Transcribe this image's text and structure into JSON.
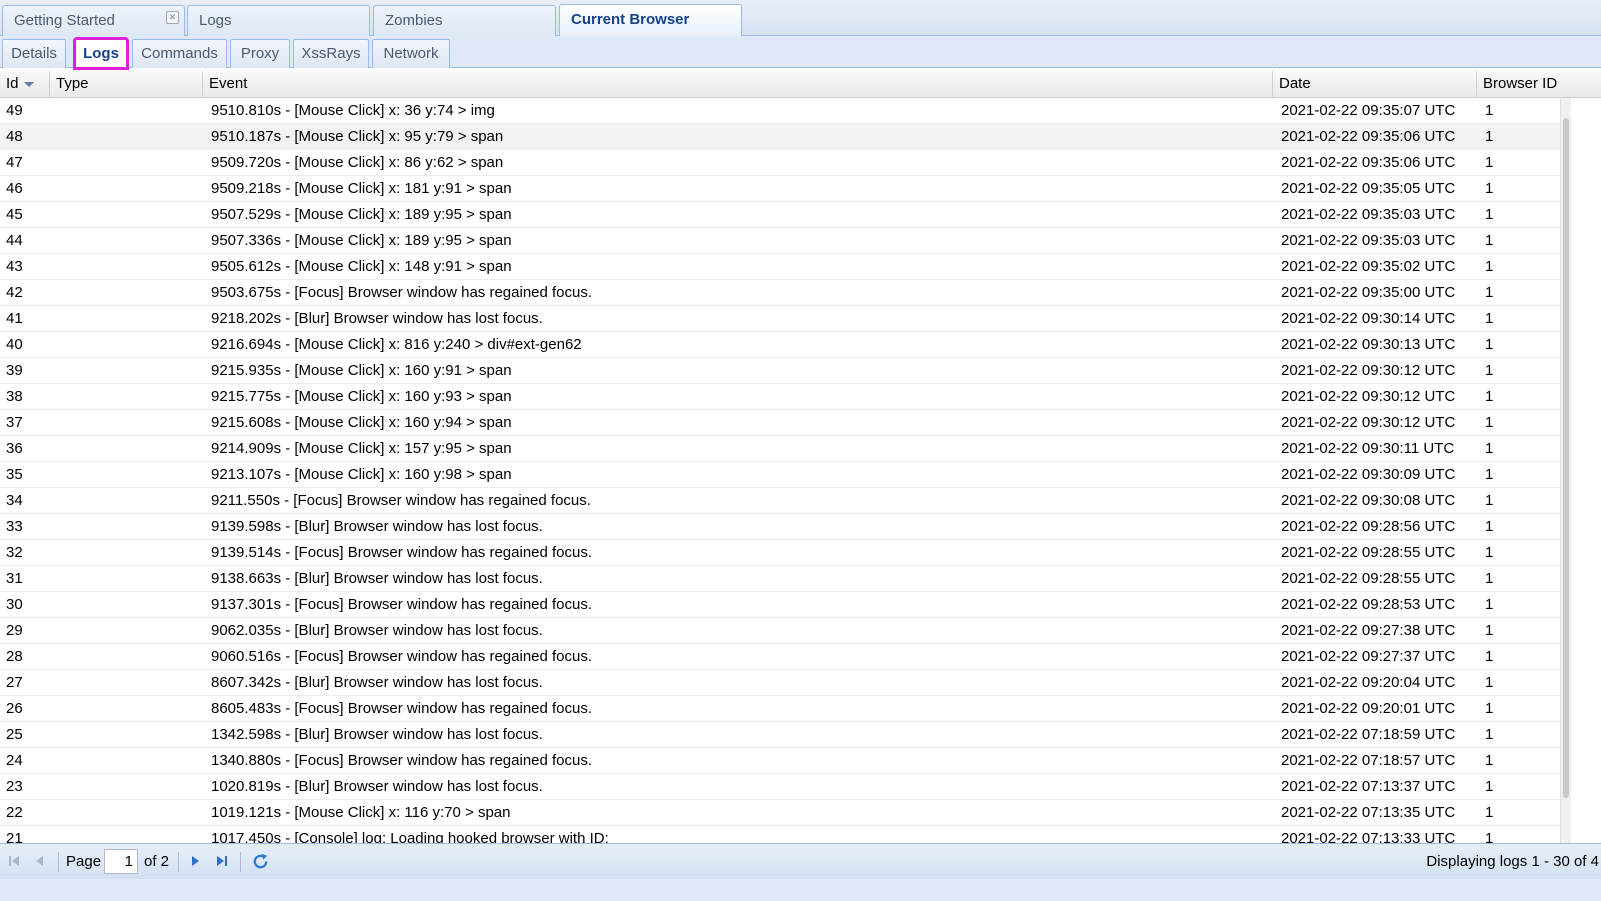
{
  "top_tabs": [
    {
      "label": "Getting Started",
      "closable": true
    },
    {
      "label": "Logs"
    },
    {
      "label": "Zombies"
    },
    {
      "label": "Current Browser",
      "active": true
    }
  ],
  "sub_tabs": [
    {
      "label": "Details"
    },
    {
      "label": "Logs",
      "active": true
    },
    {
      "label": "Commands"
    },
    {
      "label": "Proxy"
    },
    {
      "label": "XssRays"
    },
    {
      "label": "Network"
    }
  ],
  "grid": {
    "columns": {
      "id": "Id",
      "type": "Type",
      "event": "Event",
      "date": "Date",
      "browser_id": "Browser ID"
    },
    "rows": [
      {
        "id": "49",
        "type": "",
        "event": "9510.810s - [Mouse Click] x: 36 y:74 > img",
        "date": "2021-02-22 09:35:07 UTC",
        "browser_id": "1"
      },
      {
        "id": "48",
        "type": "",
        "event": "9510.187s - [Mouse Click] x: 95 y:79 > span",
        "date": "2021-02-22 09:35:06 UTC",
        "browser_id": "1"
      },
      {
        "id": "47",
        "type": "",
        "event": "9509.720s - [Mouse Click] x: 86 y:62 > span",
        "date": "2021-02-22 09:35:06 UTC",
        "browser_id": "1"
      },
      {
        "id": "46",
        "type": "",
        "event": "9509.218s - [Mouse Click] x: 181 y:91 > span",
        "date": "2021-02-22 09:35:05 UTC",
        "browser_id": "1"
      },
      {
        "id": "45",
        "type": "",
        "event": "9507.529s - [Mouse Click] x: 189 y:95 > span",
        "date": "2021-02-22 09:35:03 UTC",
        "browser_id": "1"
      },
      {
        "id": "44",
        "type": "",
        "event": "9507.336s - [Mouse Click] x: 189 y:95 > span",
        "date": "2021-02-22 09:35:03 UTC",
        "browser_id": "1"
      },
      {
        "id": "43",
        "type": "",
        "event": "9505.612s - [Mouse Click] x: 148 y:91 > span",
        "date": "2021-02-22 09:35:02 UTC",
        "browser_id": "1"
      },
      {
        "id": "42",
        "type": "",
        "event": "9503.675s - [Focus] Browser window has regained focus.",
        "date": "2021-02-22 09:35:00 UTC",
        "browser_id": "1"
      },
      {
        "id": "41",
        "type": "",
        "event": "9218.202s - [Blur] Browser window has lost focus.",
        "date": "2021-02-22 09:30:14 UTC",
        "browser_id": "1"
      },
      {
        "id": "40",
        "type": "",
        "event": "9216.694s - [Mouse Click] x: 816 y:240 > div#ext-gen62",
        "date": "2021-02-22 09:30:13 UTC",
        "browser_id": "1"
      },
      {
        "id": "39",
        "type": "",
        "event": "9215.935s - [Mouse Click] x: 160 y:91 > span",
        "date": "2021-02-22 09:30:12 UTC",
        "browser_id": "1"
      },
      {
        "id": "38",
        "type": "",
        "event": "9215.775s - [Mouse Click] x: 160 y:93 > span",
        "date": "2021-02-22 09:30:12 UTC",
        "browser_id": "1"
      },
      {
        "id": "37",
        "type": "",
        "event": "9215.608s - [Mouse Click] x: 160 y:94 > span",
        "date": "2021-02-22 09:30:12 UTC",
        "browser_id": "1"
      },
      {
        "id": "36",
        "type": "",
        "event": "9214.909s - [Mouse Click] x: 157 y:95 > span",
        "date": "2021-02-22 09:30:11 UTC",
        "browser_id": "1"
      },
      {
        "id": "35",
        "type": "",
        "event": "9213.107s - [Mouse Click] x: 160 y:98 > span",
        "date": "2021-02-22 09:30:09 UTC",
        "browser_id": "1"
      },
      {
        "id": "34",
        "type": "",
        "event": "9211.550s - [Focus] Browser window has regained focus.",
        "date": "2021-02-22 09:30:08 UTC",
        "browser_id": "1"
      },
      {
        "id": "33",
        "type": "",
        "event": "9139.598s - [Blur] Browser window has lost focus.",
        "date": "2021-02-22 09:28:56 UTC",
        "browser_id": "1"
      },
      {
        "id": "32",
        "type": "",
        "event": "9139.514s - [Focus] Browser window has regained focus.",
        "date": "2021-02-22 09:28:55 UTC",
        "browser_id": "1"
      },
      {
        "id": "31",
        "type": "",
        "event": "9138.663s - [Blur] Browser window has lost focus.",
        "date": "2021-02-22 09:28:55 UTC",
        "browser_id": "1"
      },
      {
        "id": "30",
        "type": "",
        "event": "9137.301s - [Focus] Browser window has regained focus.",
        "date": "2021-02-22 09:28:53 UTC",
        "browser_id": "1"
      },
      {
        "id": "29",
        "type": "",
        "event": "9062.035s - [Blur] Browser window has lost focus.",
        "date": "2021-02-22 09:27:38 UTC",
        "browser_id": "1"
      },
      {
        "id": "28",
        "type": "",
        "event": "9060.516s - [Focus] Browser window has regained focus.",
        "date": "2021-02-22 09:27:37 UTC",
        "browser_id": "1"
      },
      {
        "id": "27",
        "type": "",
        "event": "8607.342s - [Blur] Browser window has lost focus.",
        "date": "2021-02-22 09:20:04 UTC",
        "browser_id": "1"
      },
      {
        "id": "26",
        "type": "",
        "event": "8605.483s - [Focus] Browser window has regained focus.",
        "date": "2021-02-22 09:20:01 UTC",
        "browser_id": "1"
      },
      {
        "id": "25",
        "type": "",
        "event": "1342.598s - [Blur] Browser window has lost focus.",
        "date": "2021-02-22 07:18:59 UTC",
        "browser_id": "1"
      },
      {
        "id": "24",
        "type": "",
        "event": "1340.880s - [Focus] Browser window has regained focus.",
        "date": "2021-02-22 07:18:57 UTC",
        "browser_id": "1"
      },
      {
        "id": "23",
        "type": "",
        "event": "1020.819s - [Blur] Browser window has lost focus.",
        "date": "2021-02-22 07:13:37 UTC",
        "browser_id": "1"
      },
      {
        "id": "22",
        "type": "",
        "event": "1019.121s - [Mouse Click] x: 116 y:70 > span",
        "date": "2021-02-22 07:13:35 UTC",
        "browser_id": "1"
      },
      {
        "id": "21",
        "type": "",
        "event": "1017.450s - [Console] log: Loading hooked browser with ID:",
        "date": "2021-02-22 07:13:33 UTC",
        "browser_id": "1"
      }
    ]
  },
  "paging": {
    "page_label": "Page",
    "page_value": "1",
    "of_label": "of 2",
    "display_info": "Displaying logs 1 - 30 of 4"
  },
  "icons": {
    "first": "first-page-icon",
    "prev": "previous-page-icon",
    "next": "next-page-icon",
    "last": "last-page-icon",
    "refresh": "refresh-icon",
    "sort": "sort-desc-icon",
    "close": "close-icon"
  },
  "colors": {
    "accent": "#15428b",
    "highlight_outline": "#e020d8",
    "toolbar_bg": "#dfe8f6",
    "border": "#99bbe8"
  }
}
